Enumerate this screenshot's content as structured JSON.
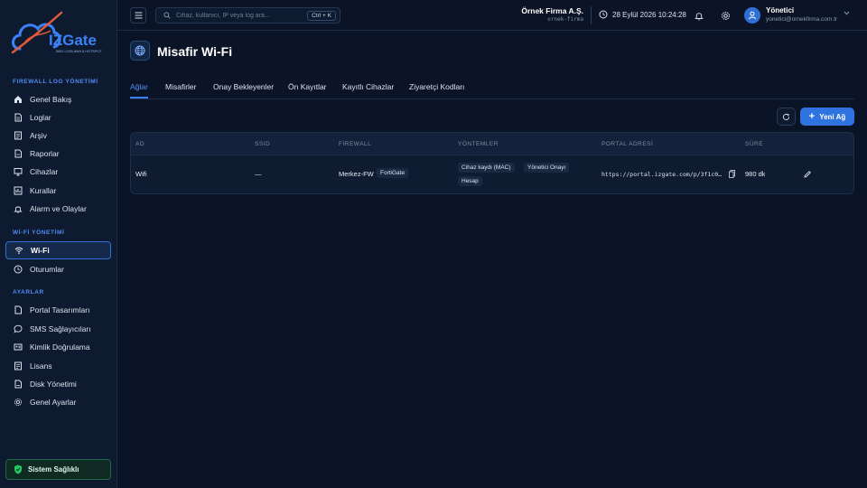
{
  "brand": {
    "name": "IZGate",
    "tagline": "5651 LOGLAMA & HOTSPOT"
  },
  "sidebar": {
    "sections": [
      {
        "title": "FIREWALL LOG YÖNETİMİ"
      },
      {
        "title": "Wİ-Fİ YÖNETİMİ"
      },
      {
        "title": "AYARLAR"
      }
    ],
    "items": [
      {
        "label": "Genel Bakış",
        "icon": "home-icon"
      },
      {
        "label": "Loglar",
        "icon": "document-icon"
      },
      {
        "label": "Arşiv",
        "icon": "archive-icon"
      },
      {
        "label": "Raporlar",
        "icon": "report-icon"
      },
      {
        "label": "Cihazlar",
        "icon": "monitor-icon"
      },
      {
        "label": "Kurallar",
        "icon": "rules-icon"
      },
      {
        "label": "Alarm ve Olaylar",
        "icon": "bell-icon"
      },
      {
        "label": "Wi-Fi",
        "icon": "wifi-icon",
        "active": true
      },
      {
        "label": "Oturumlar",
        "icon": "clock-icon"
      },
      {
        "label": "Portal Tasarımları",
        "icon": "page-icon"
      },
      {
        "label": "SMS Sağlayıcıları",
        "icon": "chat-icon"
      },
      {
        "label": "Kimlik Doğrulama",
        "icon": "id-card-icon"
      },
      {
        "label": "Lisans",
        "icon": "license-icon"
      },
      {
        "label": "Disk Yönetimi",
        "icon": "disk-icon"
      },
      {
        "label": "Genel Ayarlar",
        "icon": "gear-icon"
      }
    ],
    "health": "Sistem Sağlıklı"
  },
  "topbar": {
    "search_placeholder": "Cihaz, kullanıcı, IP veya log ara...",
    "shortcut": "Ctrl + K",
    "company": "Örnek Firma A.Ş.",
    "company_slug": "ornek-firma",
    "datetime": "28 Eylül 2026 10:24:28",
    "user_name": "Yönetici",
    "user_email": "yonetici@ornekfirma.com.tr"
  },
  "page": {
    "title": "Misafir Wi-Fi",
    "tabs": [
      "Ağlar",
      "Misafirler",
      "Onay Bekleyenler",
      "Ön Kayıtlar",
      "Kayıtlı Cihazlar",
      "Ziyaretçi Kodları"
    ],
    "new_button": "Yeni Ağ"
  },
  "table": {
    "headers": [
      "AD",
      "SSID",
      "FİREWALL",
      "YÖNTEMLER",
      "PORTAL ADRESİ",
      "SÜRE"
    ],
    "rows": [
      {
        "name": "Wifi",
        "ssid": "—",
        "firewall": "Merkez-FW",
        "firewall_type": "FortiGate",
        "methods": [
          "Cihaz kaydı (MAC)",
          "Yönetici Onayı",
          "Hesap"
        ],
        "portal": "https://portal.izgate.com/p/3f1c0…",
        "duration": "980 dk"
      }
    ]
  },
  "colors": {
    "accent": "#2f73e0",
    "background": "#0b1426",
    "sidebar": "#0e1a2f",
    "success": "#22c55e"
  }
}
